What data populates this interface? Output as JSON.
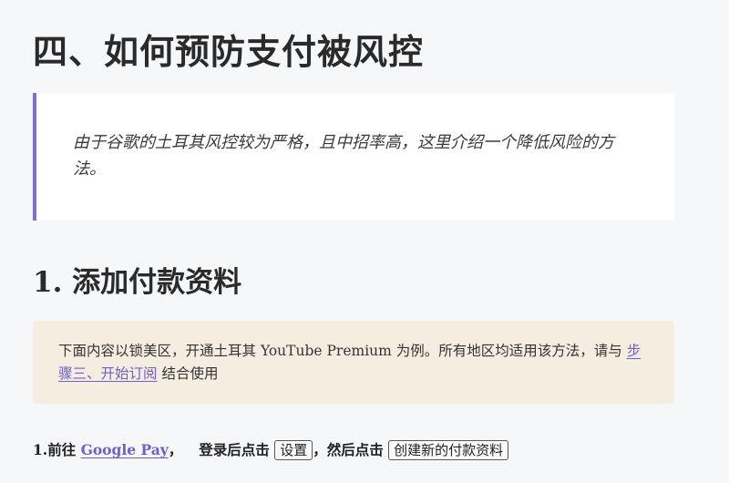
{
  "section": {
    "title": "四、如何预防支付被风控"
  },
  "quote": {
    "text": "由于谷歌的土耳其风控较为严格，且中招率高，这里介绍一个降低风险的方法。"
  },
  "subsection": {
    "number": "1.",
    "title": "添加付款资料"
  },
  "notice": {
    "text_before": "下面内容以锁美区，开通土耳其 ",
    "text_serif": "YouTube Premium",
    "text_middle": " 为例。所有地区均适用该方法，请与 ",
    "link_label": "步骤三、开始订阅",
    "text_after": " 结合使用"
  },
  "step": {
    "number": "1.",
    "prefix": "前往 ",
    "link_label": "Google Pay",
    "comma1": "，",
    "text_login": "登录后点击",
    "button_settings": "设置",
    "text_then": "，然后点击",
    "button_create": "创建新的付款资料"
  },
  "colors": {
    "accent": "#7b6fdc",
    "link": "#6a5fd8",
    "notice_bg": "#f5ede0",
    "page_bg": "#f6f7f9"
  }
}
